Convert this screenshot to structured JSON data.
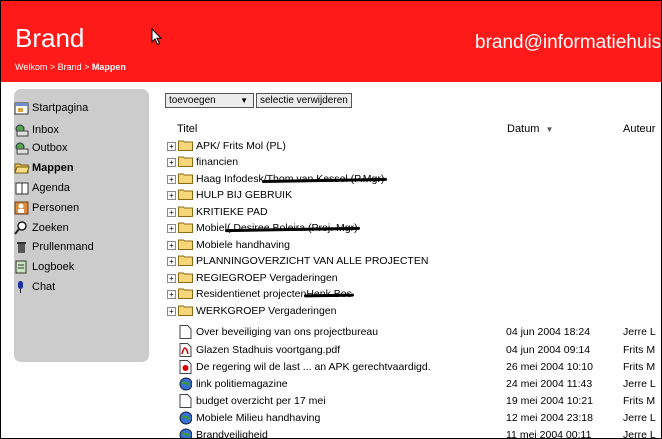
{
  "header": {
    "brand": "Brand",
    "breadcrumb_home": "Welkom",
    "breadcrumb_sep1": " > ",
    "breadcrumb_mid": "Brand",
    "breadcrumb_sep2": " > ",
    "breadcrumb_current": "Mappen",
    "email": "brand@informatiehuis.vi",
    "bg_color": "#ff1a1a"
  },
  "sidebar": {
    "items": [
      {
        "label": "Startpagina",
        "icon": "home-page-icon"
      },
      {
        "label": "Inbox",
        "icon": "inbox-icon"
      },
      {
        "label": "Outbox",
        "icon": "outbox-icon"
      },
      {
        "label": "Mappen",
        "icon": "open-folder-icon",
        "active": true
      },
      {
        "label": "Agenda",
        "icon": "agenda-icon"
      },
      {
        "label": "Personen",
        "icon": "persons-icon"
      },
      {
        "label": "Zoeken",
        "icon": "search-icon"
      },
      {
        "label": "Prullenmand",
        "icon": "trash-icon"
      },
      {
        "label": "Logboek",
        "icon": "logbook-icon"
      },
      {
        "label": "Chat",
        "icon": "chat-microphone-icon"
      }
    ]
  },
  "toolbar": {
    "add_select": "toevoegen",
    "add_arrow": "▼",
    "remove_label": "selectie verwijderen"
  },
  "columns": {
    "titel": "Titel",
    "datum": "Datum",
    "datum_sort": "▼",
    "auteur": "Auteur"
  },
  "folders": [
    {
      "name": "APK/ Frits Mol (PL)"
    },
    {
      "name": "financien"
    },
    {
      "name": "Haag Infodesk",
      "struck": "/Thom van Kessel (P.Mgr)"
    },
    {
      "name": "HULP BIJ GEBRUIK"
    },
    {
      "name": "KRITIEKE PAD"
    },
    {
      "name": "Mobiel",
      "struck": "( Desiree Boleira (Proj. Mgr)"
    },
    {
      "name": "Mobiele handhaving"
    },
    {
      "name": "PLANNINGOVERZICHT VAN ALLE PROJECTEN"
    },
    {
      "name": "REGIEGROEP Vergaderingen"
    },
    {
      "name": "Residentienet projecten",
      "struck": "Henk Bos"
    },
    {
      "name": "WERKGROEP Vergaderingen"
    }
  ],
  "files": [
    {
      "name": "Over beveiliging van ons projectbureau",
      "date": "04 jun 2004 18:24",
      "author": "Jerre L",
      "icon": "document-icon"
    },
    {
      "name": "Glazen Stadhuis voortgang.pdf",
      "date": "04 jun 2004 09:14",
      "author": "Frits M",
      "icon": "pdf-icon"
    },
    {
      "name": "De regering wil de last ... an APK gerechtvaardigd.",
      "date": "26 mei 2004 10:10",
      "author": "Frits M",
      "icon": "red-dot-document-icon"
    },
    {
      "name": "link politiemagazine",
      "date": "24 mei 2004 11:43",
      "author": "Jerre L",
      "icon": "web-link-icon"
    },
    {
      "name": "budget overzicht per 17 mei",
      "date": "19 mei 2004 10:21",
      "author": "Frits M",
      "icon": "document-icon"
    },
    {
      "name": "Mobiele Milieu handhaving",
      "date": "12 mei 2004 23:18",
      "author": "Jerre L",
      "icon": "web-link-icon"
    },
    {
      "name": "Brandveiligheid",
      "date": "11 mei 2004 00:11",
      "author": "Jerre L",
      "icon": "web-link-icon"
    }
  ]
}
